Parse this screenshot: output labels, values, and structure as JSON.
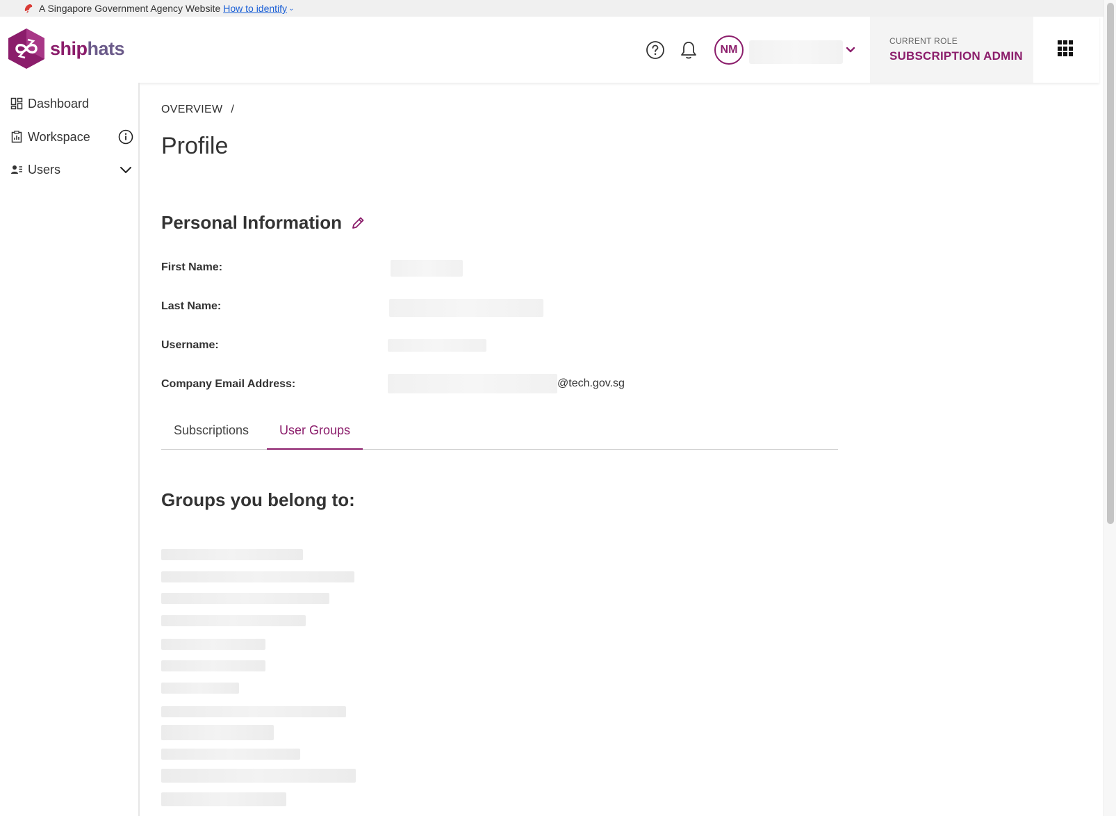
{
  "gov_banner": {
    "text": "A Singapore Government Agency Website",
    "link": "How to identify"
  },
  "header": {
    "brand_ship": "ship",
    "brand_hats": "hats",
    "avatar_initials": "NM",
    "role_label": "CURRENT ROLE",
    "role_value": "SUBSCRIPTION ADMIN"
  },
  "sidebar": {
    "items": [
      {
        "label": "Dashboard",
        "icon": "dashboard-icon"
      },
      {
        "label": "Workspace",
        "icon": "workspace-icon"
      },
      {
        "label": "Users",
        "icon": "users-icon"
      }
    ]
  },
  "main": {
    "breadcrumb": "OVERVIEW",
    "breadcrumb_sep": "/",
    "title": "Profile",
    "section_title": "Personal Information",
    "fields": {
      "first_name_label": "First Name:",
      "last_name_label": "Last Name:",
      "username_label": "Username:",
      "email_label": "Company Email Address:",
      "email_suffix": "@tech.gov.sg"
    },
    "tabs": [
      {
        "label": "Subscriptions",
        "active": false
      },
      {
        "label": "User Groups",
        "active": true
      }
    ],
    "groups_title": "Groups you belong to:"
  },
  "colors": {
    "accent": "#8b1d6b",
    "link": "#1a5fd6"
  }
}
